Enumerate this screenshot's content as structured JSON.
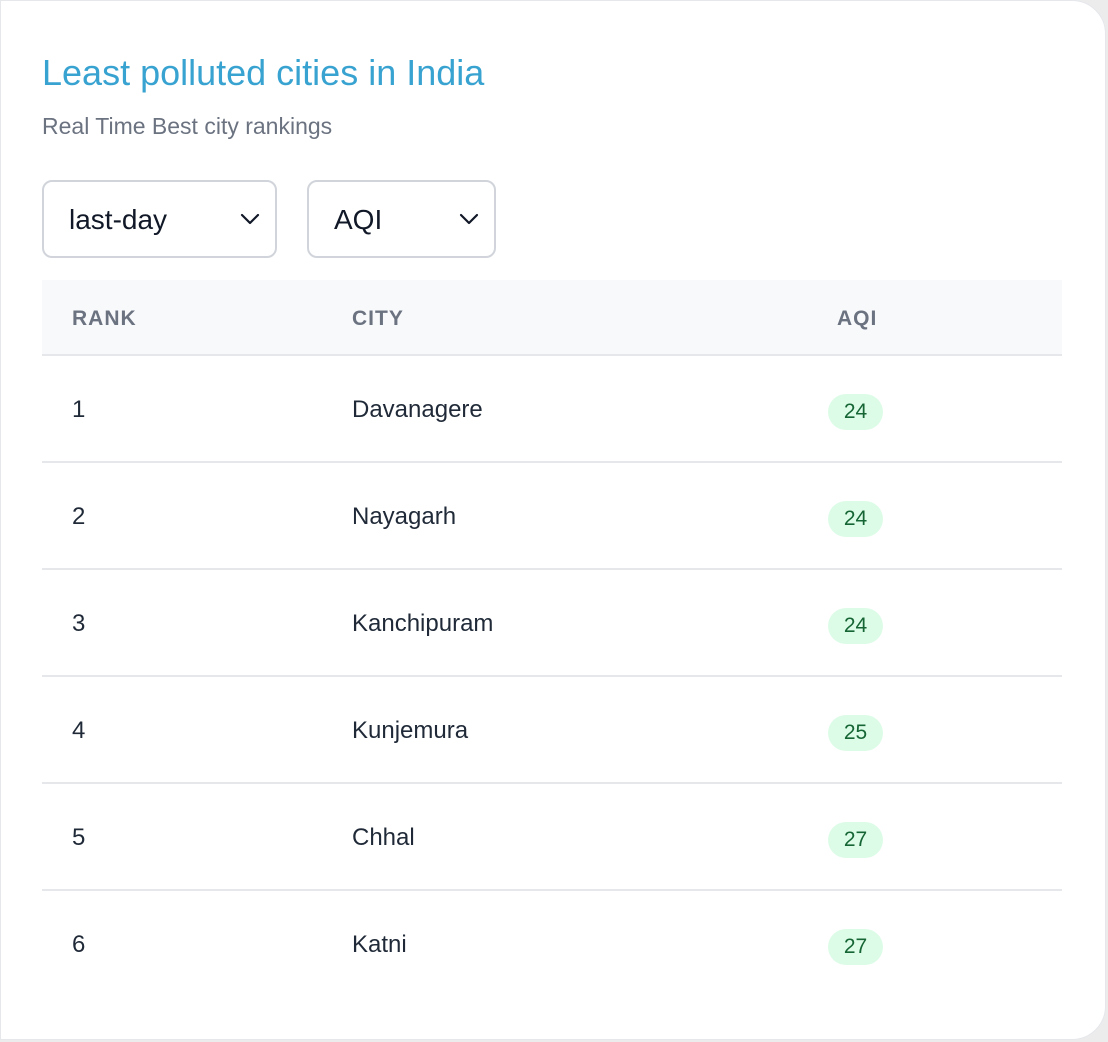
{
  "header": {
    "title": "Least polluted cities in India",
    "subtitle": "Real Time Best city rankings"
  },
  "filters": {
    "period": {
      "value": "last-day",
      "icon": "chevron-down-icon"
    },
    "metric": {
      "value": "AQI",
      "icon": "chevron-down-icon"
    }
  },
  "table": {
    "columns": [
      "RANK",
      "CITY",
      "AQI"
    ],
    "rows": [
      {
        "rank": "1",
        "city": "Davanagere",
        "aqi": "24"
      },
      {
        "rank": "2",
        "city": "Nayagarh",
        "aqi": "24"
      },
      {
        "rank": "3",
        "city": "Kanchipuram",
        "aqi": "24"
      },
      {
        "rank": "4",
        "city": "Kunjemura",
        "aqi": "25"
      },
      {
        "rank": "5",
        "city": "Chhal",
        "aqi": "27"
      },
      {
        "rank": "6",
        "city": "Katni",
        "aqi": "27"
      }
    ]
  },
  "colors": {
    "title": "#38a3d1",
    "badge_bg": "#dcfce7",
    "badge_text": "#166534"
  }
}
